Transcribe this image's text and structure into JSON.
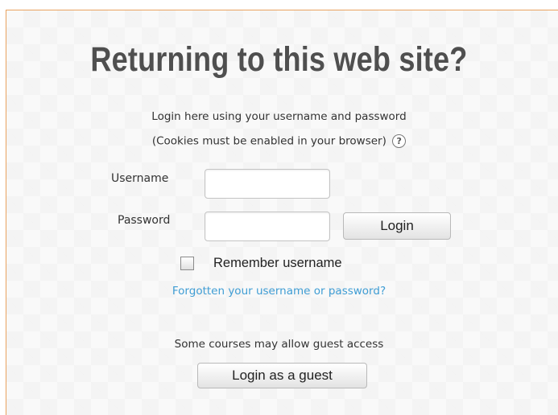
{
  "login": {
    "title": "Returning to this web site?",
    "intro": "Login here using your username and password",
    "cookies_note": "(Cookies must be enabled in your browser)",
    "help_icon_glyph": "?",
    "username_label": "Username",
    "username_value": "",
    "password_label": "Password",
    "password_value": "",
    "login_button": "Login",
    "remember_label": "Remember username",
    "remember_checked": false,
    "forgot_link": "Forgotten your username or password?",
    "guest_note": "Some courses may allow guest access",
    "guest_button": "Login as a guest"
  },
  "colors": {
    "panel_border": "#e9a25f",
    "link": "#3f9dd4",
    "title": "#4f4f4f"
  },
  "icons": {
    "help": "question-circle-icon",
    "checkbox": "checkbox-unchecked"
  }
}
